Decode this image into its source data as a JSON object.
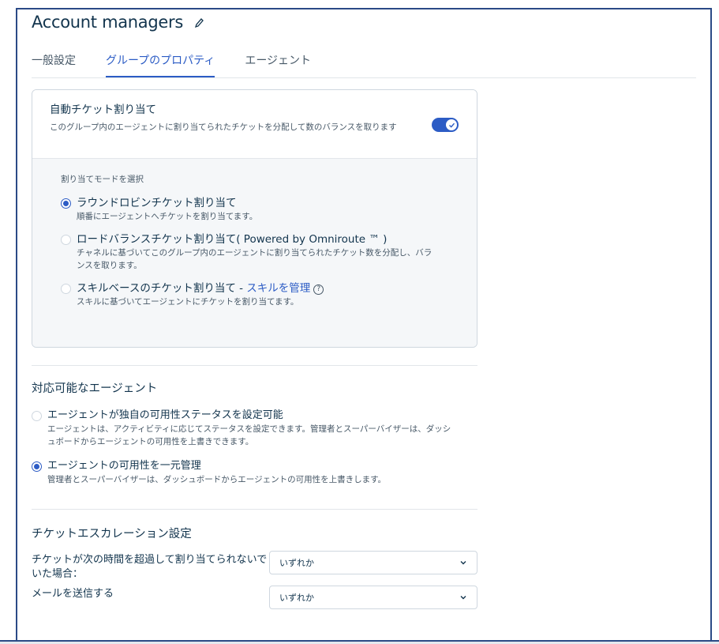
{
  "page": {
    "title": "Account managers"
  },
  "tabs": [
    {
      "label": "一般設定"
    },
    {
      "label": "グループのプロパティ"
    },
    {
      "label": "エージェント"
    }
  ],
  "auto_assign": {
    "title": "自動チケット割り当て",
    "description": "このグループ内のエージェントに割り当てられたチケットを分配して数のバランスを取ります",
    "enabled": true,
    "mode_label": "割り当てモードを選択",
    "options": [
      {
        "title": "ラウンドロビンチケット割り当て",
        "desc": "順番にエージェントへチケットを割り当てます。",
        "selected": true
      },
      {
        "title": "ロードバランスチケット割り当て( Powered by Omniroute ™ )",
        "desc": "チャネルに基づいてこのグループ内のエージェントに割り当てられたチケット数を分配し、バランスを取ります。",
        "selected": false
      },
      {
        "title": "スキルベースのチケット割り当て - ",
        "link": "スキルを管理",
        "help": "?",
        "desc": "スキルに基づいてエージェントにチケットを割り当てます。",
        "selected": false
      }
    ]
  },
  "availability": {
    "title": "対応可能なエージェント",
    "options": [
      {
        "title": "エージェントが独自の可用性ステータスを設定可能",
        "desc": "エージェントは、アクティビティに応じてステータスを設定できます。管理者とスーパーバイザーは、ダッシュボードからエージェントの可用性を上書きできます。",
        "selected": false
      },
      {
        "title": "エージェントの可用性を一元管理",
        "desc": "管理者とスーパーバイザーは、ダッシュボードからエージェントの可用性を上書きします。",
        "selected": true
      }
    ]
  },
  "escalation": {
    "title": "チケットエスカレーション設定",
    "unassigned_label": "チケットが次の時間を超過して割り当てられないでいた場合：",
    "unassigned_value": "いずれか",
    "email_label": "メールを送信する",
    "email_value": "いずれか"
  },
  "colors": {
    "accent": "#2c5cc5",
    "text": "#12344d",
    "frame": "#2b4a86"
  }
}
